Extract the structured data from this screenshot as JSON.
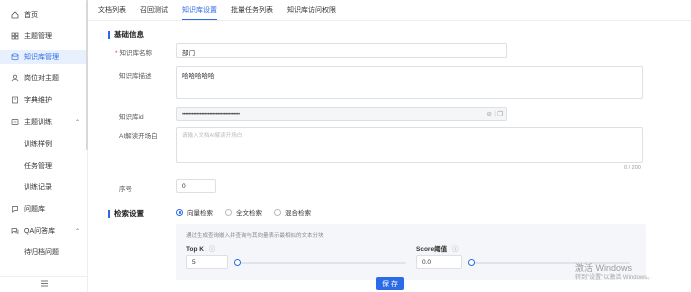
{
  "sidebar": {
    "items": [
      {
        "label": "首页",
        "icon": "home-icon",
        "active": false
      },
      {
        "label": "主题管理",
        "icon": "grid-icon",
        "active": false
      },
      {
        "label": "知识库管理",
        "icon": "database-icon",
        "active": true
      },
      {
        "label": "岗位对主题",
        "icon": "user-icon",
        "active": false
      },
      {
        "label": "字典维护",
        "icon": "book-icon",
        "active": false
      },
      {
        "label": "主题训练",
        "icon": "training-icon",
        "active": false,
        "expanded": true
      },
      {
        "label": "训练样例",
        "sub": true
      },
      {
        "label": "任务管理",
        "sub": true
      },
      {
        "label": "训练记录",
        "sub": true
      },
      {
        "label": "问题库",
        "icon": "question-icon",
        "active": false
      },
      {
        "label": "QA问答库",
        "icon": "qa-icon",
        "active": false,
        "expanded": true
      },
      {
        "label": "待归档问题",
        "sub": true
      }
    ],
    "collapse_icon": "menu-collapse-icon"
  },
  "tabs": [
    {
      "label": "文档列表",
      "active": false
    },
    {
      "label": "召回测试",
      "active": false
    },
    {
      "label": "知识库设置",
      "active": true
    },
    {
      "label": "批量任务列表",
      "active": false
    },
    {
      "label": "知识库访问权限",
      "active": false
    }
  ],
  "basic": {
    "title": "基础信息",
    "name_label": "知识库名称",
    "name_value": "部门",
    "desc_label": "知识库描述",
    "desc_value": "哈哈哈哈哈",
    "id_label": "知识库id",
    "id_value": "••••••••••••••••••••••••••••••••••••",
    "prompt_label": "AI解读开场白",
    "prompt_placeholder": "请输入文档AI解读开场白",
    "prompt_counter": "0 / 200",
    "order_label": "序号",
    "order_value": "0"
  },
  "retrieval": {
    "title": "检索设置",
    "options": [
      "向量检索",
      "全文检索",
      "混合检索"
    ],
    "selected": "向量检索",
    "hint": "通过生成查询嵌入并查询与其向量表示最相似的文本分块",
    "topk_label": "Top K",
    "topk_value": "5",
    "score_label": "Score阈值",
    "score_value": "0.0"
  },
  "footer": {
    "save_label": "保 存"
  },
  "watermark": {
    "line1": "激活 Windows",
    "line2": "转到\"设置\"以激活 Windows。"
  },
  "colors": {
    "accent": "#2b6be6",
    "active_bg": "#e8f0fe"
  }
}
